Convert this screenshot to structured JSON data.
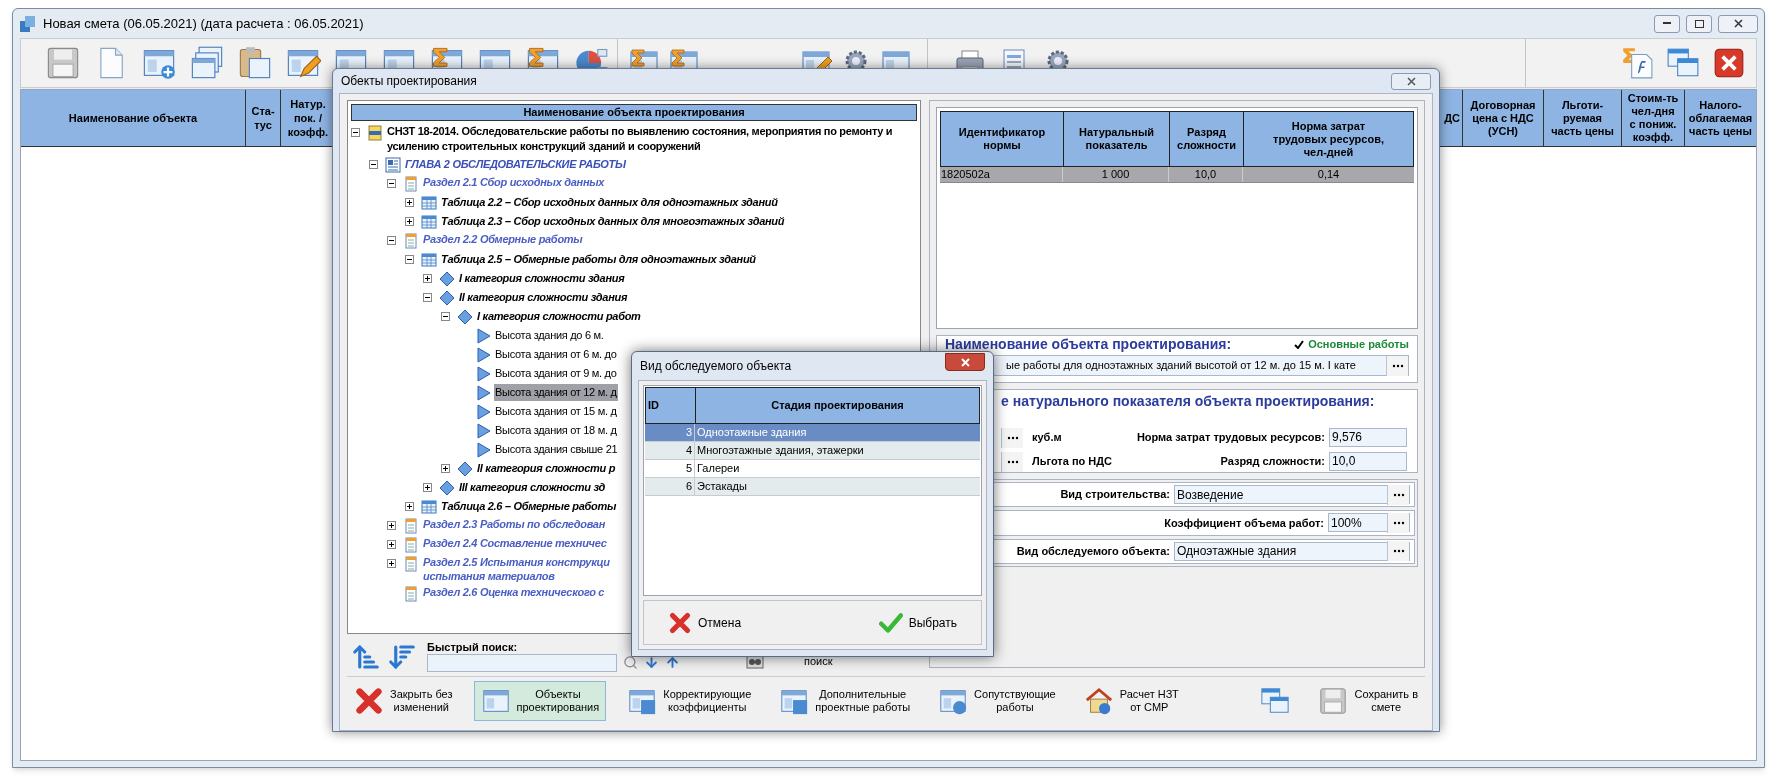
{
  "window": {
    "title": "Новая смета (06.05.2021) (дата расчета : 06.05.2021)"
  },
  "main_table": {
    "columns_left": [
      "Наименование объекта",
      "Ста-\nтус",
      "Натур.\nпок. /\nкоэфф."
    ],
    "columns_right": [
      "ДС",
      "Договорная\nцена с НДС\n(УСН)",
      "Льготи-\nруемая\nчасть цены",
      "Стоим-ть\nчел-дня\nс пониж.\nкоэфф.",
      "Налого-\nоблагаемая\nчасть цены"
    ]
  },
  "dialog": {
    "title": "Обекты проектирования",
    "tree": {
      "header": "Наименование объекта проектирования",
      "items": [
        {
          "label": "СНЗТ 18-2014. Обследовательские работы по выявлению состояния, мероприятия по ремонту и усилению строительных конструкций зданий и сооружений",
          "kind": "root",
          "expanded": true,
          "selected": false,
          "children": [
            {
              "label": "ГЛАВА 2  ОБСЛЕДОВАТЕЛЬСКИЕ РАБОТЫ",
              "kind": "chapter",
              "expanded": true,
              "selected": false,
              "children": [
                {
                  "label": "Раздел 2.1  Сбор исходных данных",
                  "kind": "section",
                  "expanded": true,
                  "selected": false,
                  "children": [
                    {
                      "label": "Таблица 2.2 – Сбор исходных данных для одноэтажных зданий",
                      "kind": "table",
                      "expanded": false,
                      "selected": false
                    },
                    {
                      "label": "Таблица 2.3 – Сбор исходных данных для многоэтажных зданий",
                      "kind": "table",
                      "expanded": false,
                      "selected": false
                    }
                  ]
                },
                {
                  "label": "Раздел 2.2  Обмерные работы",
                  "kind": "section",
                  "expanded": true,
                  "selected": false,
                  "children": [
                    {
                      "label": "Таблица 2.5 – Обмерные работы для одноэтажных зданий",
                      "kind": "table",
                      "expanded": true,
                      "selected": false,
                      "children": [
                        {
                          "label": "I категория сложности здания",
                          "kind": "category",
                          "expanded": false,
                          "selected": false
                        },
                        {
                          "label": "II категория сложности здания",
                          "kind": "category",
                          "expanded": true,
                          "selected": false,
                          "children": [
                            {
                              "label": "I категория сложности работ",
                              "kind": "category",
                              "expanded": true,
                              "selected": false,
                              "children": [
                                {
                                  "label": "Высота здания до 6 м.",
                                  "kind": "leaf",
                                  "selected": false
                                },
                                {
                                  "label": "Высота здания от 6 м. до",
                                  "kind": "leaf",
                                  "selected": false
                                },
                                {
                                  "label": "Высота здания от 9 м. до",
                                  "kind": "leaf",
                                  "selected": false
                                },
                                {
                                  "label": "Высота здания от 12 м. д",
                                  "kind": "leaf",
                                  "selected": true
                                },
                                {
                                  "label": "Высота здания от 15 м. д",
                                  "kind": "leaf",
                                  "selected": false
                                },
                                {
                                  "label": "Высота здания от 18 м. д",
                                  "kind": "leaf",
                                  "selected": false
                                },
                                {
                                  "label": "Высота здания свыше 21",
                                  "kind": "leaf",
                                  "selected": false
                                }
                              ]
                            },
                            {
                              "label": "II категория сложности р",
                              "kind": "category",
                              "expanded": false,
                              "selected": false
                            }
                          ]
                        },
                        {
                          "label": "III категория сложности зд",
                          "kind": "category",
                          "expanded": false,
                          "selected": false
                        }
                      ]
                    },
                    {
                      "label": "Таблица 2.6 – Обмерные работы",
                      "kind": "table",
                      "expanded": false,
                      "selected": false
                    }
                  ]
                },
                {
                  "label": "Раздел 2.3  Работы по обследован",
                  "kind": "section",
                  "expanded": false,
                  "selected": false
                },
                {
                  "label": "Раздел 2.4  Составление техничес",
                  "kind": "section",
                  "expanded": false,
                  "selected": false
                },
                {
                  "label": "Раздел 2.5 Испытания конструкци\nиспытания материалов",
                  "kind": "section",
                  "expanded": false,
                  "selected": false
                },
                {
                  "label": "Раздел 2.6 Оценка технического с",
                  "kind": "section",
                  "selected": false
                }
              ]
            }
          ]
        }
      ]
    },
    "search": {
      "label": "Быстрый поиск:",
      "button": "поиск"
    },
    "norm_table": {
      "columns": [
        "Идентификатор\nнормы",
        "Натуральный\nпоказатель",
        "Разряд\nсложности",
        "Норма затрат\nтрудовых ресурсов,\nчел-дней"
      ],
      "rows": [
        {
          "cells": [
            "1820502a",
            "1 000",
            "10,0",
            "0,14"
          ],
          "selected": true
        }
      ]
    },
    "object_name": {
      "label": "Наименование объекта проектирования:",
      "flag": {
        "label": "Основные работы",
        "checked": true
      },
      "value": "ые работы для одноэтажных зданий высотой от 12 м. до 15 м. I кате"
    },
    "natural_indicator": {
      "label": "е натурального показателя объекта проектирования:",
      "unit": "куб.м",
      "vat_label": "Льгота по НДС",
      "fields": [
        {
          "label": "Норма затрат трудовых ресурсов:",
          "value": "9,576"
        },
        {
          "label": "Разряд сложности:",
          "value": "10,0"
        }
      ]
    },
    "properties": [
      {
        "label": "Вид строительства:",
        "value": "Возведение",
        "kind": "wide"
      },
      {
        "label": "Коэффициент объема работ:",
        "value": "100%",
        "kind": "narrow"
      },
      {
        "label": "Вид обследуемого объекта:",
        "value": "Одноэтажные здания",
        "kind": "wide"
      }
    ],
    "buttons": [
      {
        "label": "Закрыть без\nизменений",
        "kind": "close",
        "selected": false
      },
      {
        "label": "Объекты\nпроектирования",
        "kind": "objects",
        "selected": true
      },
      {
        "label": "Корректирующие\nкоэффициенты",
        "kind": "coefficients",
        "selected": false
      },
      {
        "label": "Дополнительные\nпроектные работы",
        "kind": "extra",
        "selected": false
      },
      {
        "label": "Сопутствующие\nработы",
        "kind": "related",
        "selected": false
      },
      {
        "label": "Расчет НЗТ\nот СМР",
        "kind": "house",
        "selected": false
      },
      {
        "kind": "windows",
        "selected": false
      },
      {
        "label": "Сохранить в\nсмете",
        "kind": "save",
        "selected": false
      }
    ]
  },
  "picker": {
    "title": "Вид обследуемого объекта",
    "columns": [
      "ID",
      "Стадия проектирования"
    ],
    "rows": [
      {
        "id": "3",
        "name": "Одноэтажные здания",
        "selected": true
      },
      {
        "id": "4",
        "name": "Многоэтажные здания, этажерки",
        "selected": false
      },
      {
        "id": "5",
        "name": "Галереи",
        "selected": false
      },
      {
        "id": "6",
        "name": "Эстакады",
        "selected": false
      }
    ],
    "buttons": [
      {
        "label": "Отмена",
        "kind": "cancel"
      },
      {
        "label": "Выбрать",
        "kind": "ok"
      }
    ]
  }
}
